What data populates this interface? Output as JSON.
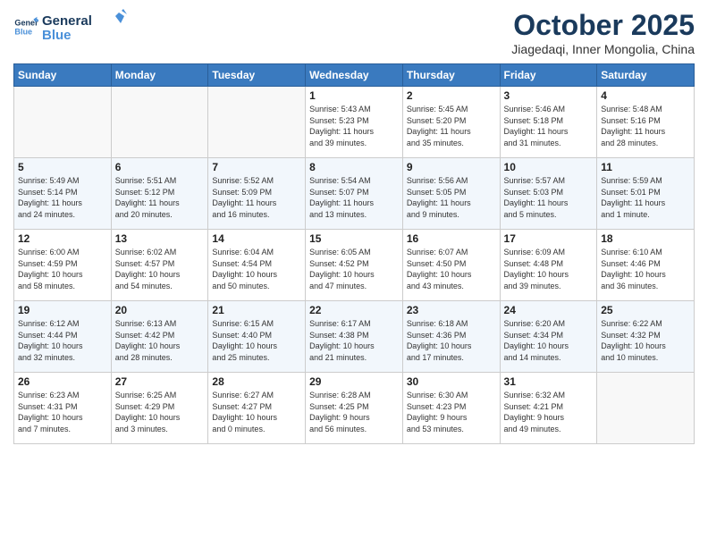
{
  "logo": {
    "line1": "General",
    "line2": "Blue"
  },
  "title": "October 2025",
  "subtitle": "Jiagedaqi, Inner Mongolia, China",
  "days_header": [
    "Sunday",
    "Monday",
    "Tuesday",
    "Wednesday",
    "Thursday",
    "Friday",
    "Saturday"
  ],
  "weeks": [
    [
      {
        "day": "",
        "info": ""
      },
      {
        "day": "",
        "info": ""
      },
      {
        "day": "",
        "info": ""
      },
      {
        "day": "1",
        "info": "Sunrise: 5:43 AM\nSunset: 5:23 PM\nDaylight: 11 hours\nand 39 minutes."
      },
      {
        "day": "2",
        "info": "Sunrise: 5:45 AM\nSunset: 5:20 PM\nDaylight: 11 hours\nand 35 minutes."
      },
      {
        "day": "3",
        "info": "Sunrise: 5:46 AM\nSunset: 5:18 PM\nDaylight: 11 hours\nand 31 minutes."
      },
      {
        "day": "4",
        "info": "Sunrise: 5:48 AM\nSunset: 5:16 PM\nDaylight: 11 hours\nand 28 minutes."
      }
    ],
    [
      {
        "day": "5",
        "info": "Sunrise: 5:49 AM\nSunset: 5:14 PM\nDaylight: 11 hours\nand 24 minutes."
      },
      {
        "day": "6",
        "info": "Sunrise: 5:51 AM\nSunset: 5:12 PM\nDaylight: 11 hours\nand 20 minutes."
      },
      {
        "day": "7",
        "info": "Sunrise: 5:52 AM\nSunset: 5:09 PM\nDaylight: 11 hours\nand 16 minutes."
      },
      {
        "day": "8",
        "info": "Sunrise: 5:54 AM\nSunset: 5:07 PM\nDaylight: 11 hours\nand 13 minutes."
      },
      {
        "day": "9",
        "info": "Sunrise: 5:56 AM\nSunset: 5:05 PM\nDaylight: 11 hours\nand 9 minutes."
      },
      {
        "day": "10",
        "info": "Sunrise: 5:57 AM\nSunset: 5:03 PM\nDaylight: 11 hours\nand 5 minutes."
      },
      {
        "day": "11",
        "info": "Sunrise: 5:59 AM\nSunset: 5:01 PM\nDaylight: 11 hours\nand 1 minute."
      }
    ],
    [
      {
        "day": "12",
        "info": "Sunrise: 6:00 AM\nSunset: 4:59 PM\nDaylight: 10 hours\nand 58 minutes."
      },
      {
        "day": "13",
        "info": "Sunrise: 6:02 AM\nSunset: 4:57 PM\nDaylight: 10 hours\nand 54 minutes."
      },
      {
        "day": "14",
        "info": "Sunrise: 6:04 AM\nSunset: 4:54 PM\nDaylight: 10 hours\nand 50 minutes."
      },
      {
        "day": "15",
        "info": "Sunrise: 6:05 AM\nSunset: 4:52 PM\nDaylight: 10 hours\nand 47 minutes."
      },
      {
        "day": "16",
        "info": "Sunrise: 6:07 AM\nSunset: 4:50 PM\nDaylight: 10 hours\nand 43 minutes."
      },
      {
        "day": "17",
        "info": "Sunrise: 6:09 AM\nSunset: 4:48 PM\nDaylight: 10 hours\nand 39 minutes."
      },
      {
        "day": "18",
        "info": "Sunrise: 6:10 AM\nSunset: 4:46 PM\nDaylight: 10 hours\nand 36 minutes."
      }
    ],
    [
      {
        "day": "19",
        "info": "Sunrise: 6:12 AM\nSunset: 4:44 PM\nDaylight: 10 hours\nand 32 minutes."
      },
      {
        "day": "20",
        "info": "Sunrise: 6:13 AM\nSunset: 4:42 PM\nDaylight: 10 hours\nand 28 minutes."
      },
      {
        "day": "21",
        "info": "Sunrise: 6:15 AM\nSunset: 4:40 PM\nDaylight: 10 hours\nand 25 minutes."
      },
      {
        "day": "22",
        "info": "Sunrise: 6:17 AM\nSunset: 4:38 PM\nDaylight: 10 hours\nand 21 minutes."
      },
      {
        "day": "23",
        "info": "Sunrise: 6:18 AM\nSunset: 4:36 PM\nDaylight: 10 hours\nand 17 minutes."
      },
      {
        "day": "24",
        "info": "Sunrise: 6:20 AM\nSunset: 4:34 PM\nDaylight: 10 hours\nand 14 minutes."
      },
      {
        "day": "25",
        "info": "Sunrise: 6:22 AM\nSunset: 4:32 PM\nDaylight: 10 hours\nand 10 minutes."
      }
    ],
    [
      {
        "day": "26",
        "info": "Sunrise: 6:23 AM\nSunset: 4:31 PM\nDaylight: 10 hours\nand 7 minutes."
      },
      {
        "day": "27",
        "info": "Sunrise: 6:25 AM\nSunset: 4:29 PM\nDaylight: 10 hours\nand 3 minutes."
      },
      {
        "day": "28",
        "info": "Sunrise: 6:27 AM\nSunset: 4:27 PM\nDaylight: 10 hours\nand 0 minutes."
      },
      {
        "day": "29",
        "info": "Sunrise: 6:28 AM\nSunset: 4:25 PM\nDaylight: 9 hours\nand 56 minutes."
      },
      {
        "day": "30",
        "info": "Sunrise: 6:30 AM\nSunset: 4:23 PM\nDaylight: 9 hours\nand 53 minutes."
      },
      {
        "day": "31",
        "info": "Sunrise: 6:32 AM\nSunset: 4:21 PM\nDaylight: 9 hours\nand 49 minutes."
      },
      {
        "day": "",
        "info": ""
      }
    ]
  ]
}
